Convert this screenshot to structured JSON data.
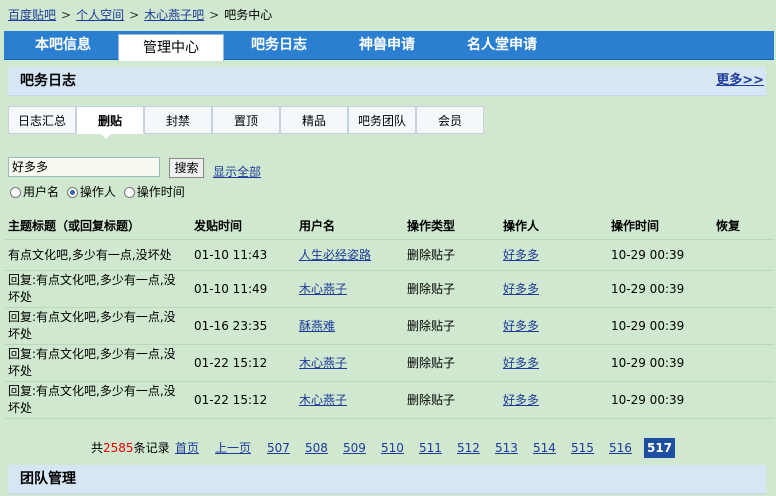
{
  "breadcrumb": {
    "items": [
      "百度贴吧",
      "个人空间",
      "木心燕子吧",
      "吧务中心"
    ],
    "separator": ">"
  },
  "nav": {
    "tabs": [
      "本吧信息",
      "管理中心",
      "吧务日志",
      "神兽申请",
      "名人堂申请"
    ],
    "active": "管理中心"
  },
  "log_section": {
    "title": "吧务日志",
    "more": "更多>>"
  },
  "subtabs": {
    "items": [
      "日志汇总",
      "删贴",
      "封禁",
      "置顶",
      "精品",
      "吧务团队",
      "会员"
    ],
    "active": "删贴"
  },
  "search": {
    "value": "好多多",
    "button": "搜索",
    "show_all": "显示全部",
    "options": [
      "用户名",
      "操作人",
      "操作时间"
    ],
    "selected": "操作人"
  },
  "table": {
    "headers": [
      "主题标题（或回复标题）",
      "发贴时间",
      "用户名",
      "操作类型",
      "操作人",
      "操作时间",
      "恢复"
    ],
    "rows": [
      {
        "title": "有点文化吧,多少有一点,没坏处",
        "post_time": "01-10 11:43",
        "user": "人生必经姿路",
        "type": "删除贴子",
        "operator": "好多多",
        "op_time": "10-29 00:39",
        "restore": ""
      },
      {
        "title": "回复:有点文化吧,多少有一点,没坏处",
        "post_time": "01-10 11:49",
        "user": "木心燕子",
        "type": "删除贴子",
        "operator": "好多多",
        "op_time": "10-29 00:39",
        "restore": ""
      },
      {
        "title": "回复:有点文化吧,多少有一点,没坏处",
        "post_time": "01-16 23:35",
        "user": "酥燕难",
        "type": "删除贴子",
        "operator": "好多多",
        "op_time": "10-29 00:39",
        "restore": ""
      },
      {
        "title": "回复:有点文化吧,多少有一点,没坏处",
        "post_time": "01-22 15:12",
        "user": "木心燕子",
        "type": "删除贴子",
        "operator": "好多多",
        "op_time": "10-29 00:39",
        "restore": ""
      },
      {
        "title": "回复:有点文化吧,多少有一点,没坏处",
        "post_time": "01-22 15:12",
        "user": "木心燕子",
        "type": "删除贴子",
        "operator": "好多多",
        "op_time": "10-29 00:39",
        "restore": ""
      }
    ]
  },
  "pager": {
    "count_prefix": "共",
    "count": "2585",
    "count_suffix": "条记录",
    "first": "首页",
    "prev": "上一页",
    "pages": [
      "507",
      "508",
      "509",
      "510",
      "511",
      "512",
      "513",
      "514",
      "515",
      "516"
    ],
    "current": "517"
  },
  "team_section": {
    "title": "团队管理"
  },
  "colors": {
    "background": "#cfe8cf",
    "nav": "#2b7fd0",
    "section_bar": "#d7e6f5",
    "link": "#1f3c9a",
    "count": "#ee0000"
  }
}
